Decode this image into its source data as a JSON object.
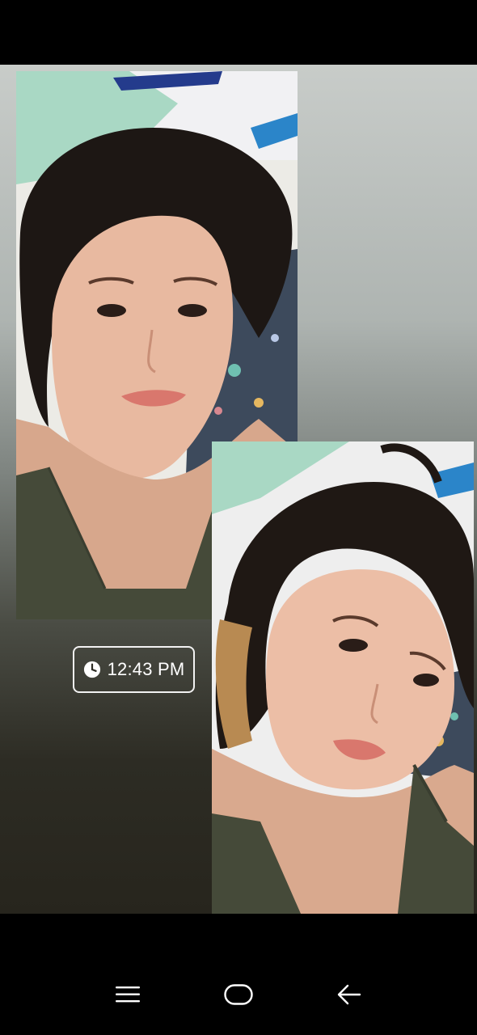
{
  "story": {
    "photos": [
      {
        "name": "selfie-photo-1"
      },
      {
        "name": "selfie-photo-2"
      }
    ],
    "time_sticker": {
      "icon": "clock-icon",
      "text": "12:43 PM"
    }
  },
  "navbar": {
    "buttons": [
      {
        "icon": "menu-icon"
      },
      {
        "icon": "home-icon"
      },
      {
        "icon": "back-icon"
      }
    ]
  },
  "colors": {
    "sticker_border": "#f2f2f2",
    "sticker_text": "#ffffff",
    "nav_icon": "#ffffff"
  }
}
